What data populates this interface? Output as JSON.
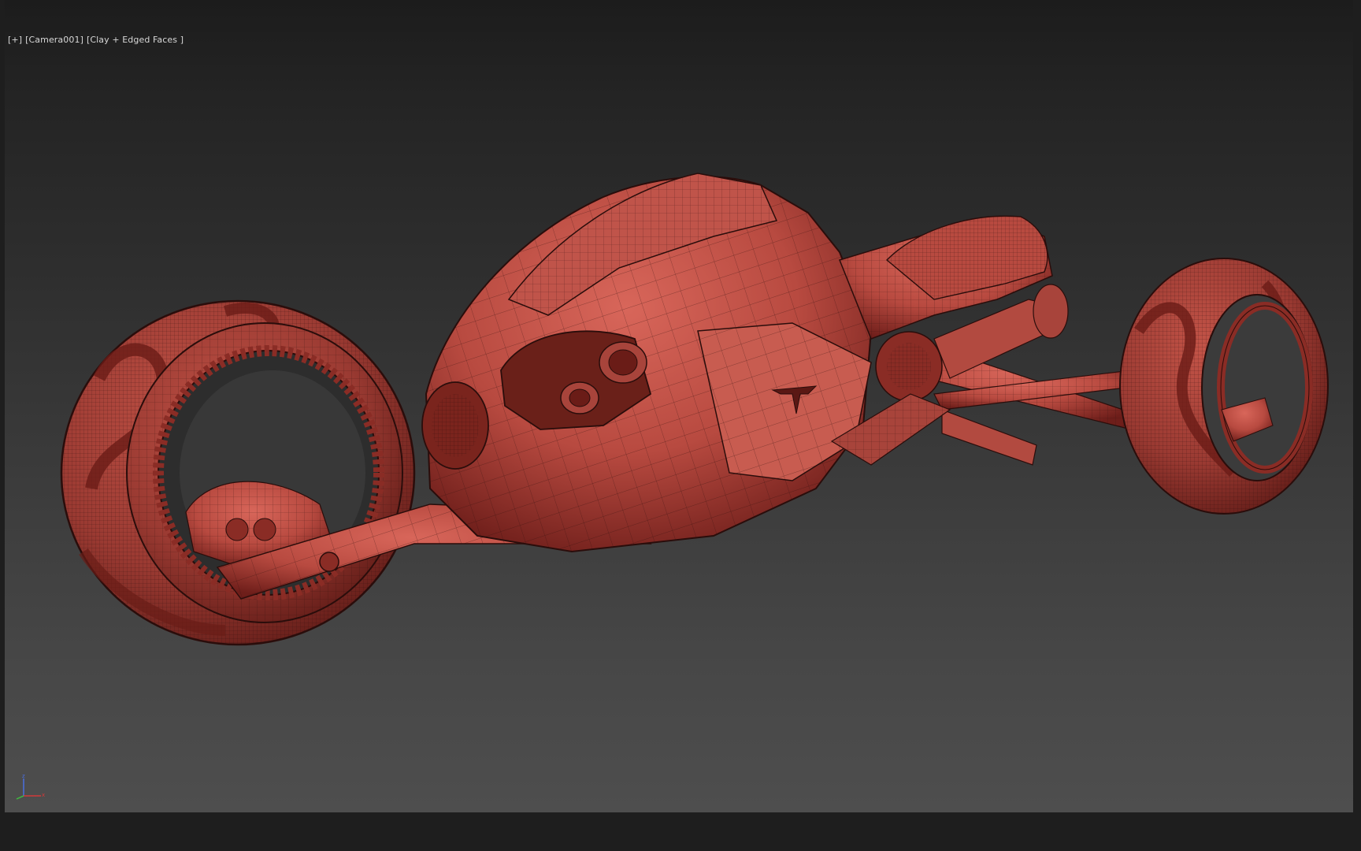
{
  "viewport": {
    "menu_plus": "[+]",
    "camera": "[Camera001]",
    "shading": "[Clay + Edged Faces ]"
  },
  "colors": {
    "clay": "#b84a40",
    "clay_dark": "#6e1e1a",
    "clay_light": "#d8665a",
    "wire": "#2a0d0b",
    "axis_x": "#d23a3a",
    "axis_y": "#3fbf3f",
    "axis_z": "#4a6fe0"
  },
  "axis_tripod": {
    "x_label": "x",
    "y_label": "y",
    "z_label": "z"
  },
  "scene": {
    "model": "sci-fi-hub-less-motorcycle",
    "icons": [
      "axis-tripod-icon"
    ]
  }
}
